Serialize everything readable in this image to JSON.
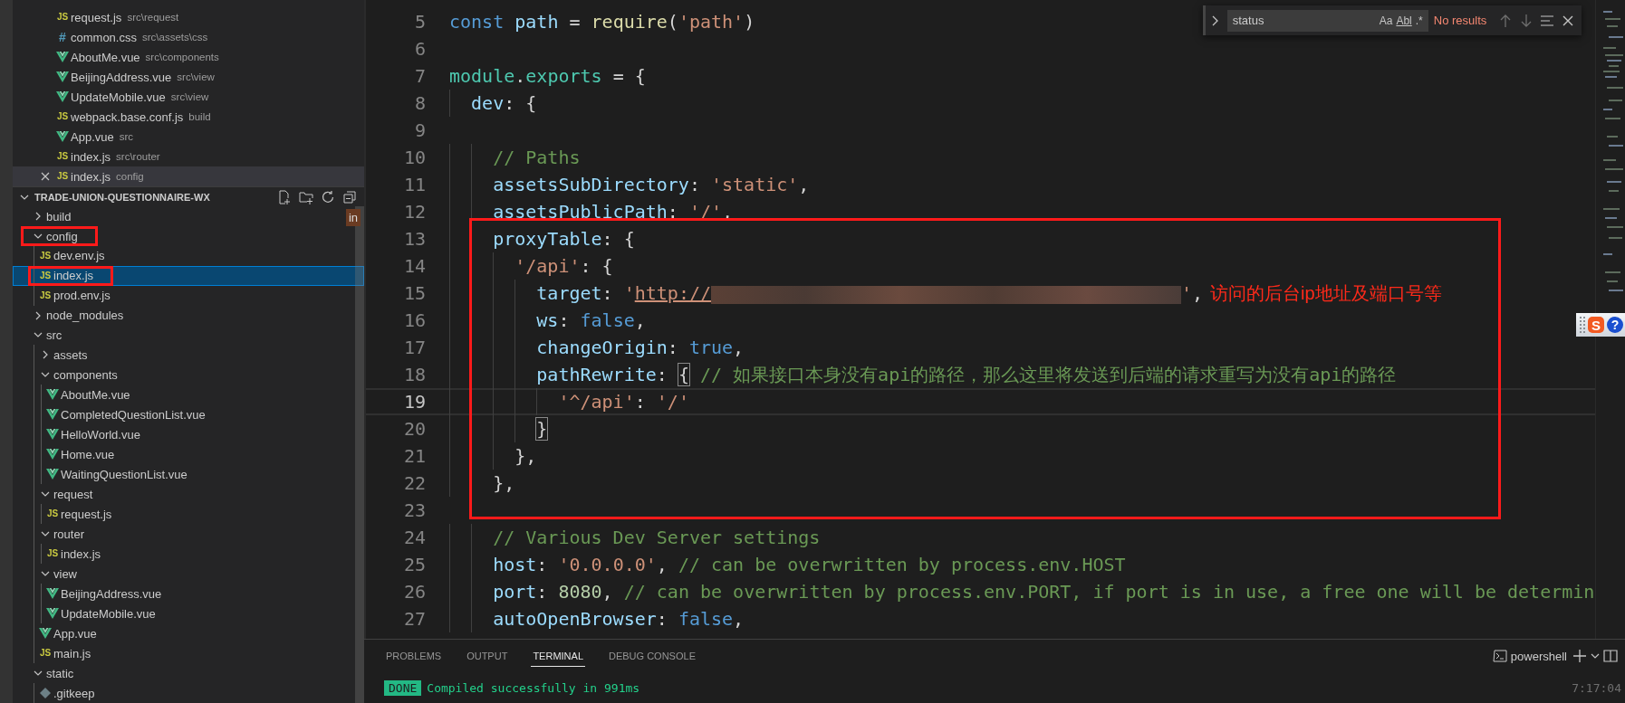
{
  "open_editors": [
    {
      "kind": "js",
      "badge": "JS",
      "name": "request.js",
      "path": "src\\request",
      "selected": false
    },
    {
      "kind": "css",
      "badge": "#",
      "name": "common.css",
      "path": "src\\assets\\css",
      "selected": false
    },
    {
      "kind": "vue",
      "name": "AboutMe.vue",
      "path": "src\\components",
      "selected": false
    },
    {
      "kind": "vue",
      "name": "BeijingAddress.vue",
      "path": "src\\view",
      "selected": false
    },
    {
      "kind": "vue",
      "name": "UpdateMobile.vue",
      "path": "src\\view",
      "selected": false
    },
    {
      "kind": "js",
      "badge": "JS",
      "name": "webpack.base.conf.js",
      "path": "build",
      "selected": false
    },
    {
      "kind": "vue",
      "name": "App.vue",
      "path": "src",
      "selected": false
    },
    {
      "kind": "js",
      "badge": "JS",
      "name": "index.js",
      "path": "src\\router",
      "selected": false
    },
    {
      "kind": "js",
      "badge": "JS",
      "name": "index.js",
      "path": "config",
      "selected": true
    }
  ],
  "explorer": {
    "title": "TRADE-UNION-QUESTIONNAIRE-WX",
    "expanded": true,
    "filter": "in",
    "tree": [
      {
        "kind": "folder",
        "name": "build",
        "expanded": false,
        "selected": false
      },
      {
        "kind": "folder",
        "name": "config",
        "expanded": true,
        "selected": false,
        "marked": true,
        "children": [
          {
            "kind": "js",
            "badge": "JS",
            "name": "dev.env.js",
            "selected": false
          },
          {
            "kind": "js",
            "badge": "JS",
            "name": "index.js",
            "selected": true,
            "marked": true
          },
          {
            "kind": "js",
            "badge": "JS",
            "name": "prod.env.js",
            "selected": false
          }
        ]
      },
      {
        "kind": "folder",
        "name": "node_modules",
        "expanded": false,
        "selected": false
      },
      {
        "kind": "folder",
        "name": "src",
        "expanded": true,
        "selected": false,
        "children": [
          {
            "kind": "folder",
            "name": "assets",
            "expanded": false,
            "selected": false
          },
          {
            "kind": "folder",
            "name": "components",
            "expanded": true,
            "selected": false,
            "children": [
              {
                "kind": "vue",
                "name": "AboutMe.vue",
                "selected": false
              },
              {
                "kind": "vue",
                "name": "CompletedQuestionList.vue",
                "selected": false
              },
              {
                "kind": "vue",
                "name": "HelloWorld.vue",
                "selected": false
              },
              {
                "kind": "vue",
                "name": "Home.vue",
                "selected": false
              },
              {
                "kind": "vue",
                "name": "WaitingQuestionList.vue",
                "selected": false
              }
            ]
          },
          {
            "kind": "folder",
            "name": "request",
            "expanded": true,
            "selected": false,
            "children": [
              {
                "kind": "js",
                "badge": "JS",
                "name": "request.js",
                "selected": false
              }
            ]
          },
          {
            "kind": "folder",
            "name": "router",
            "expanded": true,
            "selected": false,
            "children": [
              {
                "kind": "js",
                "badge": "JS",
                "name": "index.js",
                "selected": false
              }
            ]
          },
          {
            "kind": "folder",
            "name": "view",
            "expanded": true,
            "selected": false,
            "children": [
              {
                "kind": "vue",
                "name": "BeijingAddress.vue",
                "selected": false
              },
              {
                "kind": "vue",
                "name": "UpdateMobile.vue",
                "selected": false
              }
            ]
          },
          {
            "kind": "vue",
            "name": "App.vue",
            "selected": false
          },
          {
            "kind": "js",
            "badge": "JS",
            "name": "main.js",
            "selected": false
          }
        ]
      },
      {
        "kind": "folder",
        "name": "static",
        "expanded": true,
        "selected": false,
        "children": [
          {
            "kind": "gitkeep",
            "name": ".gitkeep",
            "selected": false
          }
        ]
      }
    ]
  },
  "editor": {
    "lines": [
      {
        "number": "5",
        "current": false,
        "tokens": [
          {
            "kind": "keyword",
            "text": "const"
          },
          {
            "kind": "variable",
            "text": " path"
          },
          {
            "kind": "plain",
            "text": " = "
          },
          {
            "kind": "function",
            "text": "require"
          },
          {
            "kind": "plain",
            "text": "("
          },
          {
            "kind": "string",
            "text": "'path'"
          },
          {
            "kind": "plain",
            "text": ")"
          }
        ]
      },
      {
        "number": "6",
        "current": false
      },
      {
        "number": "7",
        "current": false,
        "tokens": [
          {
            "kind": "type",
            "text": "module"
          },
          {
            "kind": "plain",
            "text": "."
          },
          {
            "kind": "type",
            "text": "exports"
          },
          {
            "kind": "plain",
            "text": " = {"
          }
        ]
      },
      {
        "number": "8",
        "current": false,
        "tokens": [
          {
            "kind": "property",
            "text": "dev"
          },
          {
            "kind": "plain",
            "text": ": {"
          }
        ]
      },
      {
        "number": "9",
        "current": false
      },
      {
        "number": "10",
        "current": false,
        "tokens": [
          {
            "kind": "comment",
            "text": "// Paths"
          }
        ]
      },
      {
        "number": "11",
        "current": false,
        "tokens": [
          {
            "kind": "property",
            "text": "assetsSubDirectory"
          },
          {
            "kind": "plain",
            "text": ": "
          },
          {
            "kind": "string",
            "text": "'static'"
          },
          {
            "kind": "plain",
            "text": ","
          }
        ]
      },
      {
        "number": "12",
        "current": false,
        "tokens": [
          {
            "kind": "property",
            "text": "assetsPublicPath"
          },
          {
            "kind": "plain",
            "text": ": "
          },
          {
            "kind": "string",
            "text": "'/'"
          },
          {
            "kind": "plain",
            "text": ","
          }
        ]
      },
      {
        "number": "13",
        "current": false,
        "marked": true,
        "tokens": [
          {
            "kind": "property",
            "text": "proxyTable"
          },
          {
            "kind": "plain",
            "text": ": {"
          }
        ]
      },
      {
        "number": "14",
        "current": false,
        "marked": true,
        "tokens": [
          {
            "kind": "string",
            "text": "'/api'"
          },
          {
            "kind": "plain",
            "text": ": {"
          }
        ]
      },
      {
        "number": "15",
        "current": false,
        "marked": true,
        "tokens": [
          {
            "kind": "property",
            "text": "target"
          },
          {
            "kind": "plain",
            "text": ": "
          },
          {
            "kind": "string",
            "text": "'"
          },
          {
            "kind": "link",
            "text": "http://"
          },
          {
            "kind": "redacted"
          },
          {
            "kind": "string",
            "text": "'"
          },
          {
            "kind": "plain",
            "text": ","
          },
          {
            "kind": "note",
            "text": "访问的后台ip地址及端口号等"
          }
        ]
      },
      {
        "number": "16",
        "current": false,
        "marked": true,
        "tokens": [
          {
            "kind": "property",
            "text": "ws"
          },
          {
            "kind": "plain",
            "text": ": "
          },
          {
            "kind": "boolean",
            "text": "false"
          },
          {
            "kind": "plain",
            "text": ","
          }
        ]
      },
      {
        "number": "17",
        "current": false,
        "marked": true,
        "tokens": [
          {
            "kind": "property",
            "text": "changeOrigin"
          },
          {
            "kind": "plain",
            "text": ": "
          },
          {
            "kind": "boolean",
            "text": "true"
          },
          {
            "kind": "plain",
            "text": ","
          }
        ]
      },
      {
        "number": "18",
        "current": false,
        "marked": true,
        "tokens": [
          {
            "kind": "property",
            "text": "pathRewrite"
          },
          {
            "kind": "plain",
            "text": ": "
          },
          {
            "kind": "bracket",
            "text": "{"
          },
          {
            "kind": "comment",
            "text": " // 如果接口本身没有api的路径，那么这里将发送到后端的请求重写为没有api的路径"
          }
        ]
      },
      {
        "number": "19",
        "current": true,
        "marked": true,
        "tokens": [
          {
            "kind": "string",
            "text": "'^/api'"
          },
          {
            "kind": "plain",
            "text": ": "
          },
          {
            "kind": "string",
            "text": "'/'"
          }
        ]
      },
      {
        "number": "20",
        "current": false,
        "marked": true,
        "tokens": [
          {
            "kind": "bracket",
            "text": "}"
          }
        ]
      },
      {
        "number": "21",
        "current": false,
        "marked": true,
        "tokens": [
          {
            "kind": "plain",
            "text": "},"
          }
        ]
      },
      {
        "number": "22",
        "current": false,
        "marked": true,
        "tokens": [
          {
            "kind": "plain",
            "text": "},"
          }
        ]
      },
      {
        "number": "23",
        "current": false,
        "marked": true
      },
      {
        "number": "24",
        "current": false,
        "tokens": [
          {
            "kind": "comment",
            "text": "// Various Dev Server settings"
          }
        ]
      },
      {
        "number": "25",
        "current": false,
        "tokens": [
          {
            "kind": "property",
            "text": "host"
          },
          {
            "kind": "plain",
            "text": ": "
          },
          {
            "kind": "string",
            "text": "'0.0.0.0'"
          },
          {
            "kind": "plain",
            "text": ", "
          },
          {
            "kind": "comment",
            "text": "// can be overwritten by process.env.HOST"
          }
        ]
      },
      {
        "number": "26",
        "current": false,
        "tokens": [
          {
            "kind": "property",
            "text": "port"
          },
          {
            "kind": "plain",
            "text": ": "
          },
          {
            "kind": "number",
            "text": "8080"
          },
          {
            "kind": "plain",
            "text": ", "
          },
          {
            "kind": "comment",
            "text": "// can be overwritten by process.env.PORT, if port is in use, a free one will be determin"
          }
        ]
      },
      {
        "number": "27",
        "current": false,
        "tokens": [
          {
            "kind": "property",
            "text": "autoOpenBrowser"
          },
          {
            "kind": "plain",
            "text": ": "
          },
          {
            "kind": "boolean",
            "text": "false"
          },
          {
            "kind": "plain",
            "text": ","
          }
        ]
      }
    ],
    "find": {
      "value": "status",
      "options": [
        "Aa",
        "Abl",
        ".*"
      ],
      "result": "No results"
    }
  },
  "ime_toolbar": {
    "logo": "S",
    "help": "?"
  },
  "panel": {
    "tabs": [
      {
        "label": "PROBLEMS",
        "selected": false
      },
      {
        "label": "OUTPUT",
        "selected": false
      },
      {
        "label": "TERMINAL",
        "selected": true
      },
      {
        "label": "DEBUG CONSOLE",
        "selected": false
      }
    ],
    "shell": "powershell",
    "output": {
      "badge": "DONE",
      "message": "Compiled successfully in 991ms",
      "time": "7:17:04"
    }
  }
}
